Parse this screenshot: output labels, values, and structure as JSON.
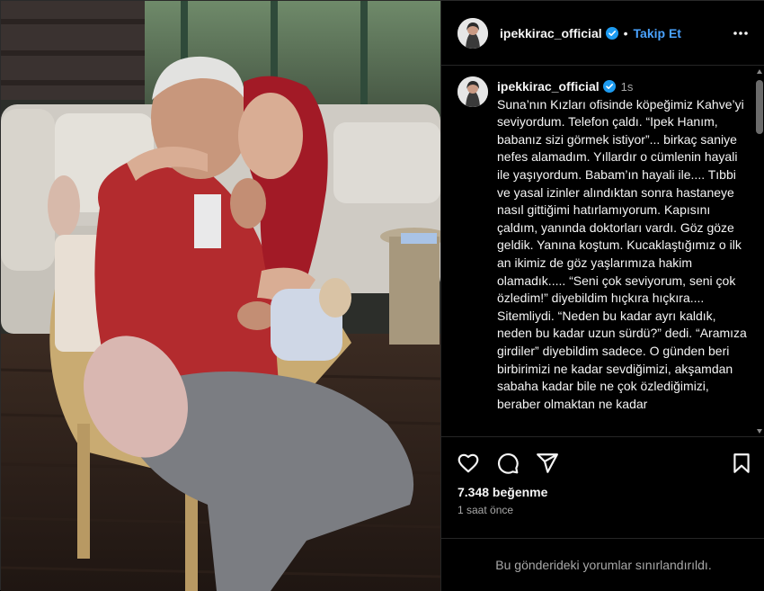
{
  "post": {
    "username": "ipekkirac_official",
    "follow_label": "Takip Et",
    "time_ago_short": "1s",
    "caption": "Suna’nın Kızları ofisinde köpeğimiz Kahve’yi seviyordum. Telefon çaldı. “Ipek Hanım, babanız sizi görmek istiyor”... birkaç saniye nefes alamadım. Yıllardır o cümlenin hayali ile yaşıyordum. Babam’ın hayali ile.... Tıbbi ve yasal izinler alındıktan sonra hastaneye nasıl gittiğimi hatırlamıyorum. Kapısını çaldım, yanında doktorları vardı. Göz göze geldik. Yanına koştum. Kucaklaştığımız o ilk an ikimiz de göz yaşlarımıza hakim olamadık..... “Seni çok seviyorum, seni çok özledim!” diyebildim hıçkıra hıçkıra.... Sitemliydi. “Neden bu kadar ayrı kaldık, neden bu kadar uzun sürdü?” dedi. “Aramıza girdiler” diyebildim sadece. O günden beri birbirimizi ne kadar sevdiğimizi, akşamdan sabaha kadar bile ne çok özlediğimizi, beraber olmaktan ne kadar",
    "likes": "7.348 beğenme",
    "time_ago": "1 saat önce",
    "comments_restricted": "Bu gönderideki yorumlar sınırlandırıldı."
  },
  "icons": {
    "verified": "verified-badge-icon",
    "more": "more-options-icon",
    "like": "heart-icon",
    "comment": "comment-icon",
    "share": "share-icon",
    "save": "bookmark-icon"
  },
  "colors": {
    "background": "#000000",
    "link": "#4aa3ff",
    "verified": "#1d9bf0",
    "muted": "#a8a8a8"
  }
}
